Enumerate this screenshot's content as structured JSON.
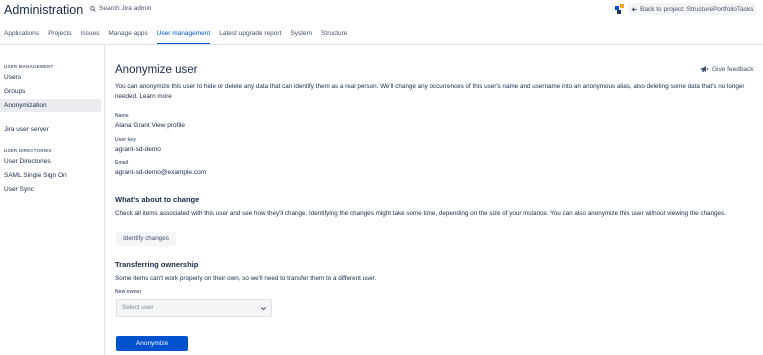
{
  "header": {
    "title": "Administration",
    "search_label": "Search Jira admin",
    "back_label": "Back to project: StructurePortfolioTasks"
  },
  "tabs": [
    {
      "label": "Applications"
    },
    {
      "label": "Projects"
    },
    {
      "label": "Issues"
    },
    {
      "label": "Manage apps"
    },
    {
      "label": "User management",
      "active": true
    },
    {
      "label": "Latest upgrade report"
    },
    {
      "label": "System"
    },
    {
      "label": "Structure"
    }
  ],
  "sidebar": {
    "section1_heading": "USER MANAGEMENT",
    "items": [
      {
        "label": "Users"
      },
      {
        "label": "Groups"
      },
      {
        "label": "Anonymization",
        "active": true
      },
      {
        "label": "Jira user server"
      },
      {
        "label": "User Directories"
      },
      {
        "label": "SAML Single Sign On"
      },
      {
        "label": "User Sync"
      }
    ],
    "section2_heading": "USER DIRECTORIES"
  },
  "main": {
    "title": "Anonymize user",
    "feedback_label": "Give feedback",
    "intro_text": "You can anonymize this user to hide or delete any data that can identify them as a real person. We'll change any occurrences of this user's name and username into an anonymous alias, also deleting some data that's no longer needed.",
    "learn_more": "Learn more",
    "name_label": "Name",
    "name_value": "Alana Grant",
    "view_profile": "View profile",
    "user_key_label": "User key",
    "user_key_value": "agrant-sd-demo",
    "email_label": "Email",
    "email_value": "agrant-sd-demo@example.com",
    "change_title": "What's about to change",
    "change_text": "Check all items associated with this user and see how they'll change. Identifying the changes might take some time, depending on the size of your instance. You can also anonymize this user without viewing the changes.",
    "identify_button": "Identify changes",
    "transfer_title": "Transferring ownership",
    "transfer_text": "Some items can't work properly on their own, so we'll need to transfer them to a different user.",
    "new_owner_label": "New owner",
    "select_placeholder": "Select user",
    "anonymize_button": "Anonymize"
  },
  "colors": {
    "accent": "#0052cc",
    "text": "#172b4d",
    "muted": "#5e6c84",
    "sidebar_active": "#ebecf0"
  }
}
